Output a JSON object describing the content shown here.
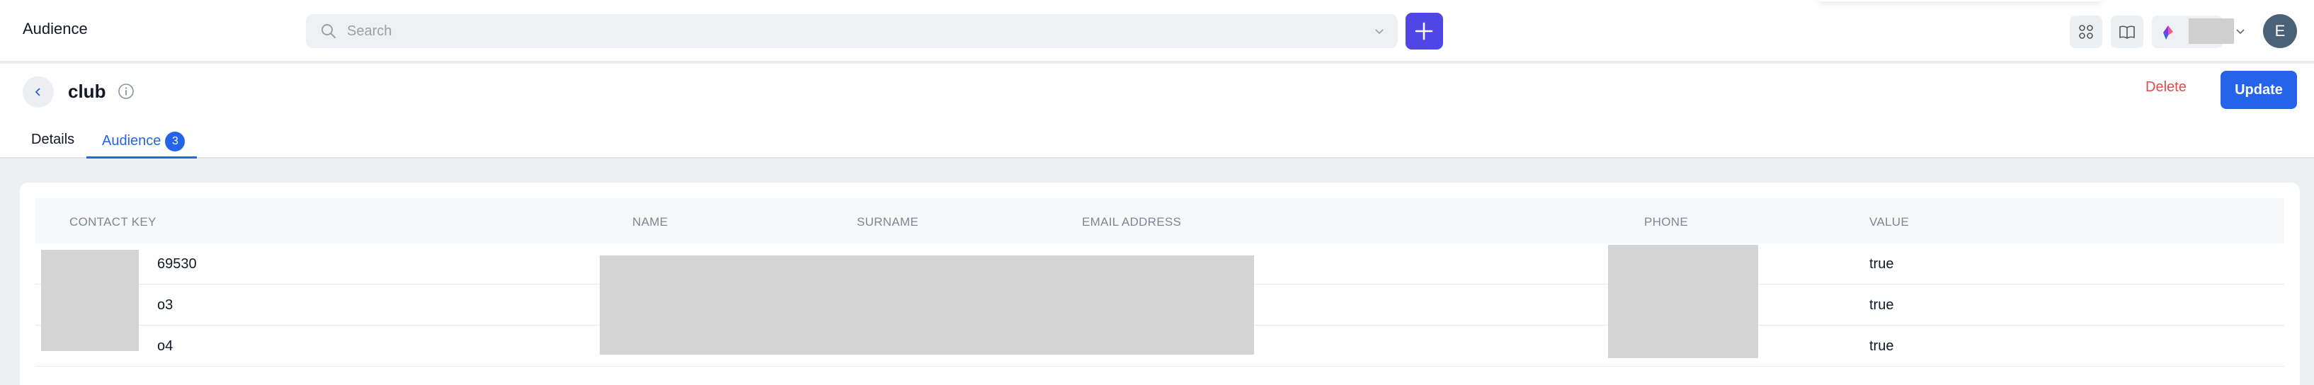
{
  "header": {
    "app_title": "Audience",
    "search_placeholder": "Search",
    "avatar_initial": "E"
  },
  "icons": {
    "search": "search-icon",
    "add": "plus-icon",
    "apps": "grid-icon",
    "docs": "book-icon",
    "org": "brand-logo",
    "back": "chevron-left-icon",
    "info": "info-icon"
  },
  "page": {
    "title": "club",
    "delete_label": "Delete",
    "update_label": "Update"
  },
  "tabs": [
    {
      "label": "Details"
    },
    {
      "label": "Audience",
      "count": "3"
    }
  ],
  "table": {
    "columns": [
      "CONTACT KEY",
      "NAME",
      "SURNAME",
      "EMAIL ADDRESS",
      "PHONE",
      "VALUE"
    ],
    "rows": [
      {
        "contact_key": "69530",
        "value": "true"
      },
      {
        "contact_key": "o3",
        "value": "true"
      },
      {
        "contact_key": "o4",
        "value": "true"
      }
    ]
  },
  "colors": {
    "accent": "#2563eb",
    "add_button": "#4f46e5",
    "danger": "#e5484d",
    "avatar": "#4a6277"
  }
}
